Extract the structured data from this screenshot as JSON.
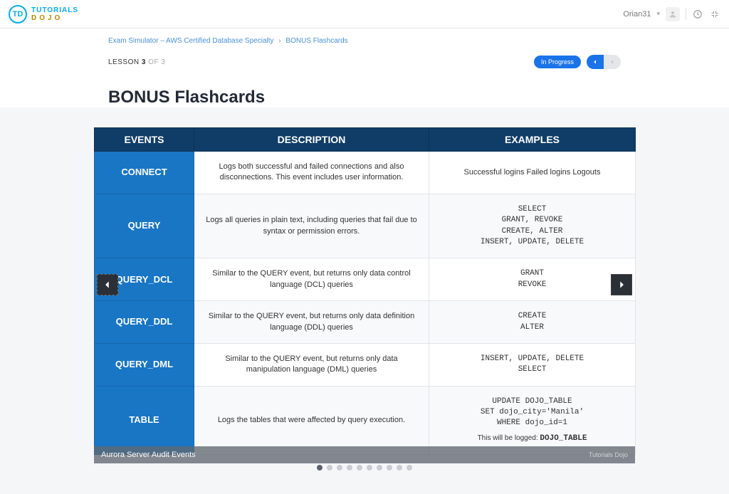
{
  "brand": {
    "initials": "TD",
    "line1": "TUTORIALS",
    "line2": "DOJO"
  },
  "user": {
    "name": "Orian31"
  },
  "breadcrumb": {
    "parent": "Exam Simulator – AWS Certified Database Specialty",
    "current": "BONUS Flashcards"
  },
  "lesson": {
    "label": "LESSON",
    "current": "3",
    "of_text": "OF",
    "total": "3"
  },
  "status": "In Progress",
  "page_title": "BONUS Flashcards",
  "headers": {
    "events": "EVENTS",
    "description": "DESCRIPTION",
    "examples": "EXAMPLES"
  },
  "rows": [
    {
      "event": "CONNECT",
      "desc": "Logs both successful and failed connections and also disconnections. This event includes user information.",
      "example_lines": [
        "Successful logins",
        "Failed logins",
        "Logouts"
      ],
      "mono": false
    },
    {
      "event": "QUERY",
      "desc": "Logs all queries in plain text, including queries that fail due to syntax or permission errors.",
      "example_lines": [
        "SELECT",
        "GRANT, REVOKE",
        "CREATE, ALTER",
        "INSERT, UPDATE, DELETE"
      ],
      "mono": true
    },
    {
      "event": "QUERY_DCL",
      "desc": "Similar to the QUERY event, but returns only data control language (DCL) queries",
      "example_lines": [
        "GRANT",
        "REVOKE"
      ],
      "mono": true
    },
    {
      "event": "QUERY_DDL",
      "desc": "Similar to the QUERY event, but returns only data definition language (DDL) queries",
      "example_lines": [
        "CREATE",
        "ALTER"
      ],
      "mono": true
    },
    {
      "event": "QUERY_DML",
      "desc": "Similar to the QUERY event, but returns only data manipulation language (DML) queries",
      "example_lines": [
        "INSERT, UPDATE, DELETE",
        "SELECT"
      ],
      "mono": true
    },
    {
      "event": "TABLE",
      "desc": "Logs the tables that were affected by query execution.",
      "example_lines": [
        "UPDATE DOJO_TABLE",
        "SET dojo_city='Manila'",
        "WHERE dojo_id=1"
      ],
      "mono": true,
      "footer": "This will be logged:",
      "footer_val": "DOJO_TABLE"
    }
  ],
  "caption": "Aurora Server Audit Events",
  "caption_wm": "Tutorials Dojo",
  "dots": {
    "count": 10,
    "active": 0
  }
}
